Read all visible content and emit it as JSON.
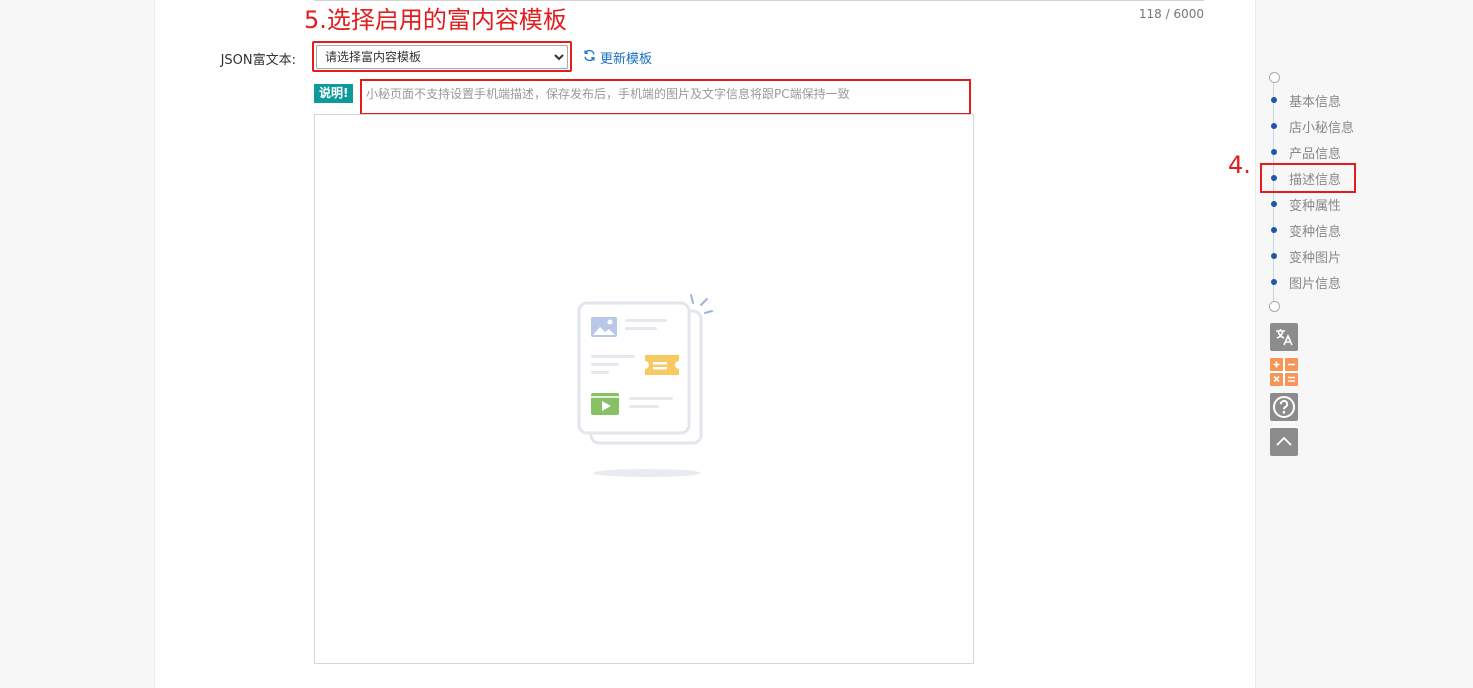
{
  "editor": {
    "char_count": "118 / 6000",
    "json_label": "JSON富文本:",
    "select_value": "请选择富内容模板",
    "refresh_label": "更新模板",
    "note_badge": "说明!",
    "note_text": "小秘页面不支持设置手机端描述，保存发布后，手机端的图片及文字信息将跟PC端保持一致"
  },
  "annotations": {
    "step5": "5.选择启用的富内容模板",
    "step4": "4."
  },
  "side_nav": {
    "items": [
      {
        "label": "基本信息"
      },
      {
        "label": "店小秘信息"
      },
      {
        "label": "产品信息"
      },
      {
        "label": "描述信息"
      },
      {
        "label": "变种属性"
      },
      {
        "label": "变种信息"
      },
      {
        "label": "变种图片"
      },
      {
        "label": "图片信息"
      }
    ]
  },
  "tools": [
    {
      "icon": "translate-icon"
    },
    {
      "icon": "calculator-icon"
    },
    {
      "icon": "help-icon"
    },
    {
      "icon": "back-to-top-icon"
    }
  ],
  "colors": {
    "annotation_red": "#e21d1d",
    "badge_teal": "#0e9a9a",
    "link_blue": "#1a6fc1",
    "nav_dot_blue": "#1e57a8",
    "calculator_orange": "#f59557"
  }
}
